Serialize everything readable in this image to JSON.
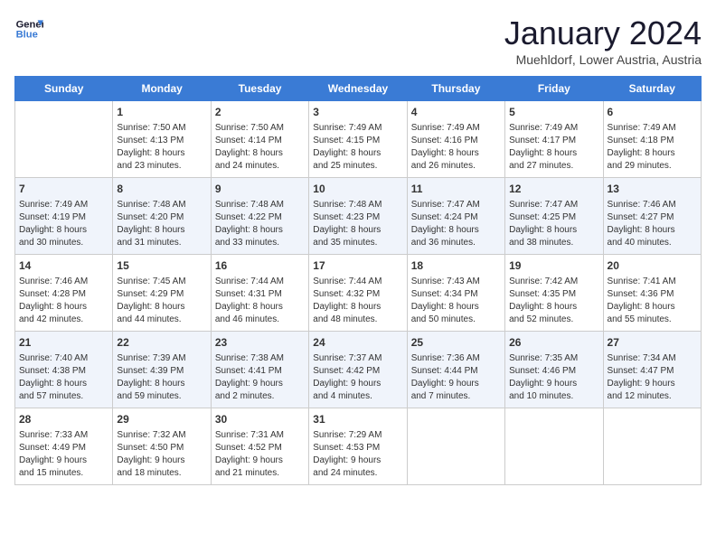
{
  "header": {
    "logo_line1": "General",
    "logo_line2": "Blue",
    "title": "January 2024",
    "subtitle": "Muehldorf, Lower Austria, Austria"
  },
  "days_of_week": [
    "Sunday",
    "Monday",
    "Tuesday",
    "Wednesday",
    "Thursday",
    "Friday",
    "Saturday"
  ],
  "weeks": [
    [
      {
        "day": "",
        "info": ""
      },
      {
        "day": "1",
        "info": "Sunrise: 7:50 AM\nSunset: 4:13 PM\nDaylight: 8 hours\nand 23 minutes."
      },
      {
        "day": "2",
        "info": "Sunrise: 7:50 AM\nSunset: 4:14 PM\nDaylight: 8 hours\nand 24 minutes."
      },
      {
        "day": "3",
        "info": "Sunrise: 7:49 AM\nSunset: 4:15 PM\nDaylight: 8 hours\nand 25 minutes."
      },
      {
        "day": "4",
        "info": "Sunrise: 7:49 AM\nSunset: 4:16 PM\nDaylight: 8 hours\nand 26 minutes."
      },
      {
        "day": "5",
        "info": "Sunrise: 7:49 AM\nSunset: 4:17 PM\nDaylight: 8 hours\nand 27 minutes."
      },
      {
        "day": "6",
        "info": "Sunrise: 7:49 AM\nSunset: 4:18 PM\nDaylight: 8 hours\nand 29 minutes."
      }
    ],
    [
      {
        "day": "7",
        "info": "Sunrise: 7:49 AM\nSunset: 4:19 PM\nDaylight: 8 hours\nand 30 minutes."
      },
      {
        "day": "8",
        "info": "Sunrise: 7:48 AM\nSunset: 4:20 PM\nDaylight: 8 hours\nand 31 minutes."
      },
      {
        "day": "9",
        "info": "Sunrise: 7:48 AM\nSunset: 4:22 PM\nDaylight: 8 hours\nand 33 minutes."
      },
      {
        "day": "10",
        "info": "Sunrise: 7:48 AM\nSunset: 4:23 PM\nDaylight: 8 hours\nand 35 minutes."
      },
      {
        "day": "11",
        "info": "Sunrise: 7:47 AM\nSunset: 4:24 PM\nDaylight: 8 hours\nand 36 minutes."
      },
      {
        "day": "12",
        "info": "Sunrise: 7:47 AM\nSunset: 4:25 PM\nDaylight: 8 hours\nand 38 minutes."
      },
      {
        "day": "13",
        "info": "Sunrise: 7:46 AM\nSunset: 4:27 PM\nDaylight: 8 hours\nand 40 minutes."
      }
    ],
    [
      {
        "day": "14",
        "info": "Sunrise: 7:46 AM\nSunset: 4:28 PM\nDaylight: 8 hours\nand 42 minutes."
      },
      {
        "day": "15",
        "info": "Sunrise: 7:45 AM\nSunset: 4:29 PM\nDaylight: 8 hours\nand 44 minutes."
      },
      {
        "day": "16",
        "info": "Sunrise: 7:44 AM\nSunset: 4:31 PM\nDaylight: 8 hours\nand 46 minutes."
      },
      {
        "day": "17",
        "info": "Sunrise: 7:44 AM\nSunset: 4:32 PM\nDaylight: 8 hours\nand 48 minutes."
      },
      {
        "day": "18",
        "info": "Sunrise: 7:43 AM\nSunset: 4:34 PM\nDaylight: 8 hours\nand 50 minutes."
      },
      {
        "day": "19",
        "info": "Sunrise: 7:42 AM\nSunset: 4:35 PM\nDaylight: 8 hours\nand 52 minutes."
      },
      {
        "day": "20",
        "info": "Sunrise: 7:41 AM\nSunset: 4:36 PM\nDaylight: 8 hours\nand 55 minutes."
      }
    ],
    [
      {
        "day": "21",
        "info": "Sunrise: 7:40 AM\nSunset: 4:38 PM\nDaylight: 8 hours\nand 57 minutes."
      },
      {
        "day": "22",
        "info": "Sunrise: 7:39 AM\nSunset: 4:39 PM\nDaylight: 8 hours\nand 59 minutes."
      },
      {
        "day": "23",
        "info": "Sunrise: 7:38 AM\nSunset: 4:41 PM\nDaylight: 9 hours\nand 2 minutes."
      },
      {
        "day": "24",
        "info": "Sunrise: 7:37 AM\nSunset: 4:42 PM\nDaylight: 9 hours\nand 4 minutes."
      },
      {
        "day": "25",
        "info": "Sunrise: 7:36 AM\nSunset: 4:44 PM\nDaylight: 9 hours\nand 7 minutes."
      },
      {
        "day": "26",
        "info": "Sunrise: 7:35 AM\nSunset: 4:46 PM\nDaylight: 9 hours\nand 10 minutes."
      },
      {
        "day": "27",
        "info": "Sunrise: 7:34 AM\nSunset: 4:47 PM\nDaylight: 9 hours\nand 12 minutes."
      }
    ],
    [
      {
        "day": "28",
        "info": "Sunrise: 7:33 AM\nSunset: 4:49 PM\nDaylight: 9 hours\nand 15 minutes."
      },
      {
        "day": "29",
        "info": "Sunrise: 7:32 AM\nSunset: 4:50 PM\nDaylight: 9 hours\nand 18 minutes."
      },
      {
        "day": "30",
        "info": "Sunrise: 7:31 AM\nSunset: 4:52 PM\nDaylight: 9 hours\nand 21 minutes."
      },
      {
        "day": "31",
        "info": "Sunrise: 7:29 AM\nSunset: 4:53 PM\nDaylight: 9 hours\nand 24 minutes."
      },
      {
        "day": "",
        "info": ""
      },
      {
        "day": "",
        "info": ""
      },
      {
        "day": "",
        "info": ""
      }
    ]
  ]
}
